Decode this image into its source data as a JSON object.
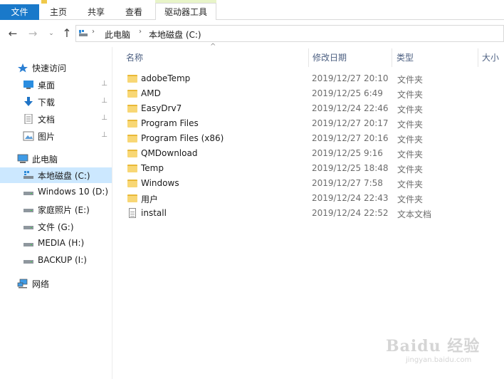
{
  "ribbon": {
    "tabs": {
      "file": "文件",
      "home": "主页",
      "share": "共享",
      "view": "查看",
      "drive_tools": "驱动器工具"
    }
  },
  "navigation": {
    "back_icon": "←",
    "forward_icon": "→",
    "recent_icon": "⌄",
    "up_icon": "↑",
    "breadcrumbs": [
      "此电脑",
      "本地磁盘 (C:)"
    ],
    "separator": "›"
  },
  "sidebar": {
    "quick_access": {
      "label": "快速访问",
      "items": [
        {
          "label": "桌面",
          "icon": "desktop-icon",
          "pinned": true
        },
        {
          "label": "下载",
          "icon": "download-icon",
          "pinned": true
        },
        {
          "label": "文档",
          "icon": "documents-icon",
          "pinned": true
        },
        {
          "label": "图片",
          "icon": "pictures-icon",
          "pinned": true
        }
      ]
    },
    "this_pc": {
      "label": "此电脑",
      "drives": [
        {
          "label": "本地磁盘 (C:)",
          "selected": true
        },
        {
          "label": "Windows 10 (D:)",
          "selected": false
        },
        {
          "label": "家庭照片 (E:)",
          "selected": false
        },
        {
          "label": "文件 (G:)",
          "selected": false
        },
        {
          "label": "MEDIA (H:)",
          "selected": false
        },
        {
          "label": "BACKUP (I:)",
          "selected": false
        }
      ]
    },
    "network": {
      "label": "网络"
    },
    "pin_glyph": "📌"
  },
  "file_list": {
    "columns": {
      "name": "名称",
      "modified": "修改日期",
      "type": "类型",
      "size": "大小"
    },
    "sort_indicator": "^",
    "rows": [
      {
        "name": "adobeTemp",
        "modified": "2019/12/27 20:10",
        "type": "文件夹",
        "kind": "folder"
      },
      {
        "name": "AMD",
        "modified": "2019/12/25 6:49",
        "type": "文件夹",
        "kind": "folder"
      },
      {
        "name": "EasyDrv7",
        "modified": "2019/12/24 22:46",
        "type": "文件夹",
        "kind": "folder"
      },
      {
        "name": "Program Files",
        "modified": "2019/12/27 20:17",
        "type": "文件夹",
        "kind": "folder"
      },
      {
        "name": "Program Files (x86)",
        "modified": "2019/12/27 20:16",
        "type": "文件夹",
        "kind": "folder"
      },
      {
        "name": "QMDownload",
        "modified": "2019/12/25 9:16",
        "type": "文件夹",
        "kind": "folder"
      },
      {
        "name": "Temp",
        "modified": "2019/12/25 18:48",
        "type": "文件夹",
        "kind": "folder"
      },
      {
        "name": "Windows",
        "modified": "2019/12/27 7:58",
        "type": "文件夹",
        "kind": "folder"
      },
      {
        "name": "用户",
        "modified": "2019/12/24 22:43",
        "type": "文件夹",
        "kind": "folder"
      },
      {
        "name": "install",
        "modified": "2019/12/24 22:52",
        "type": "文本文档",
        "kind": "document"
      }
    ]
  },
  "watermark": {
    "text": "Baidu 经验",
    "url": "jingyan.baidu.com"
  },
  "colors": {
    "accent": "#1979ca",
    "selection": "#cce8ff",
    "folder": "#f8d775",
    "header_text": "#4d6082"
  }
}
